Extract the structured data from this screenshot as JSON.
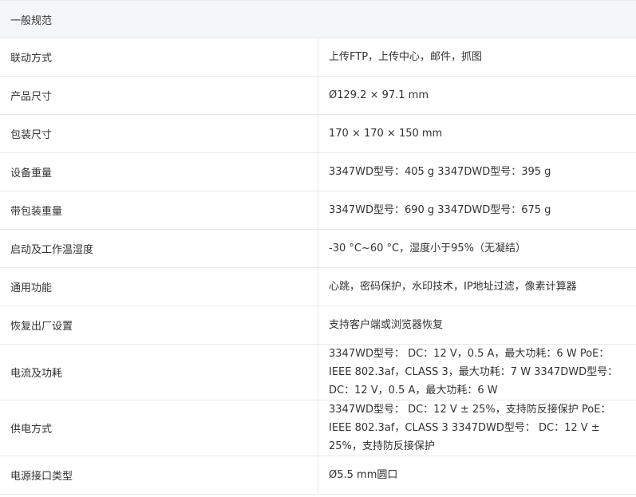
{
  "section_title": "一般规范",
  "rows": [
    {
      "label": "联动方式",
      "value": "上传FTP，上传中心，邮件，抓图"
    },
    {
      "label": "产品尺寸",
      "value": "Ø129.2 × 97.1 mm"
    },
    {
      "label": "包装尺寸",
      "value": "170 × 170 × 150 mm"
    },
    {
      "label": "设备重量",
      "value": "3347WD型号：405 g 3347DWD型号：395 g"
    },
    {
      "label": "带包装重量",
      "value": "3347WD型号：690 g 3347DWD型号：675 g"
    },
    {
      "label": "启动及工作温湿度",
      "value": "-30 °C~60 °C，湿度小于95%（无凝结）"
    },
    {
      "label": "通用功能",
      "value": "心跳，密码保护，水印技术，IP地址过滤，像素计算器"
    },
    {
      "label": "恢复出厂设置",
      "value": "支持客户端或浏览器恢复"
    },
    {
      "label": "电流及功耗",
      "value": "3347WD型号： DC：12 V，0.5 A，最大功耗：6 W PoE：IEEE 802.3af，CLASS 3，最大功耗：7 W 3347DWD型号： DC：12 V，0.5 A，最大功耗：6 W"
    },
    {
      "label": "供电方式",
      "value": "3347WD型号： DC：12 V ± 25%，支持防反接保护 PoE：IEEE 802.3af，CLASS 3 3347DWD型号： DC：12 V ± 25%，支持防反接保护"
    },
    {
      "label": "电源接口类型",
      "value": "Ø5.5 mm圆口"
    }
  ]
}
